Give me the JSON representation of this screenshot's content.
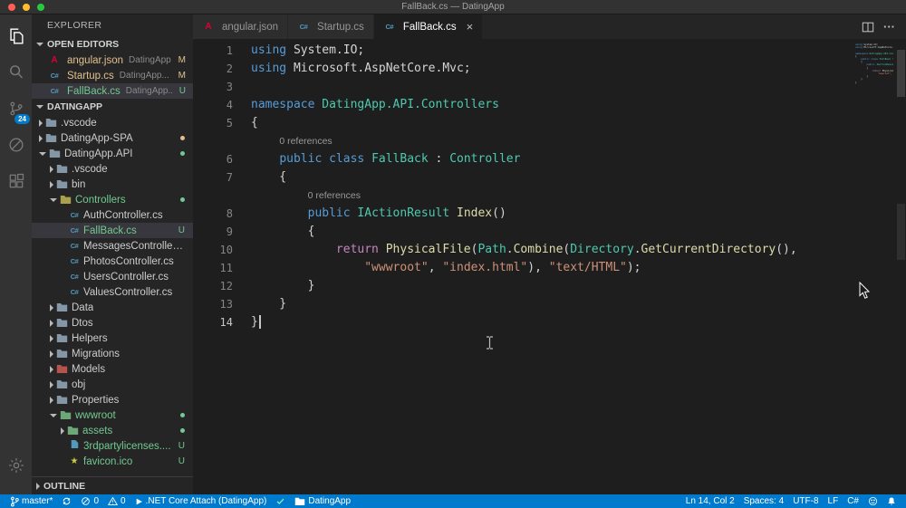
{
  "colors": {
    "accent": "#007acc",
    "modified": "#e2c08d",
    "untracked": "#73c991",
    "keyword": "#569cd6",
    "control": "#c586c0",
    "type": "#4ec9b0",
    "method": "#dcdcaa",
    "string": "#ce9178",
    "default_text": "#d4d4d4"
  },
  "title_bar": {
    "title": "FallBack.cs — DatingApp"
  },
  "activity_bar": {
    "items": [
      {
        "icon": "explorer",
        "active": true
      },
      {
        "icon": "search",
        "active": false
      },
      {
        "icon": "source-control",
        "active": false,
        "badge": "24"
      },
      {
        "icon": "debug",
        "active": false
      },
      {
        "icon": "extensions",
        "active": false
      }
    ],
    "bottom_items": [
      {
        "icon": "settings"
      }
    ]
  },
  "sidebar": {
    "title": "EXPLORER",
    "open_editors_label": "OPEN EDITORS",
    "open_editors": [
      {
        "file": "angular.json",
        "detail": "DatingApp...",
        "badge": "M",
        "icon": "angular",
        "color": "#e2c08d",
        "selected": false
      },
      {
        "file": "Startup.cs",
        "detail": "DatingApp...",
        "badge": "M",
        "icon": "csharp",
        "color": "#e2c08d",
        "selected": false
      },
      {
        "file": "FallBack.cs",
        "detail": "DatingApp...",
        "badge": "U",
        "icon": "csharp",
        "color": "#73c991",
        "selected": true
      }
    ],
    "project_label": "DATINGAPP",
    "tree": [
      {
        "label": ".vscode",
        "kind": "folder",
        "indent": 0,
        "expanded": false
      },
      {
        "label": "DatingApp-SPA",
        "kind": "folder",
        "indent": 0,
        "expanded": false,
        "dot": "#e2c08d"
      },
      {
        "label": "DatingApp.API",
        "kind": "folder",
        "indent": 0,
        "expanded": true,
        "dot": "#73c991"
      },
      {
        "label": ".vscode",
        "kind": "folder",
        "indent": 1,
        "expanded": false
      },
      {
        "label": "bin",
        "kind": "folder",
        "indent": 1,
        "expanded": false
      },
      {
        "label": "Controllers",
        "kind": "folder",
        "indent": 1,
        "expanded": true,
        "color": "#73c991",
        "dot": "#73c991",
        "folder_color": "#a9a14c"
      },
      {
        "label": "AuthController.cs",
        "kind": "file",
        "icon": "csharp",
        "indent": 2
      },
      {
        "label": "FallBack.cs",
        "kind": "file",
        "icon": "csharp",
        "indent": 2,
        "color": "#73c991",
        "badge": "U",
        "selected": true
      },
      {
        "label": "MessagesController.cs",
        "kind": "file",
        "icon": "csharp",
        "indent": 2
      },
      {
        "label": "PhotosController.cs",
        "kind": "file",
        "icon": "csharp",
        "indent": 2
      },
      {
        "label": "UsersController.cs",
        "kind": "file",
        "icon": "csharp",
        "indent": 2
      },
      {
        "label": "ValuesController.cs",
        "kind": "file",
        "icon": "csharp",
        "indent": 2
      },
      {
        "label": "Data",
        "kind": "folder",
        "indent": 1,
        "expanded": false
      },
      {
        "label": "Dtos",
        "kind": "folder",
        "indent": 1,
        "expanded": false
      },
      {
        "label": "Helpers",
        "kind": "folder",
        "indent": 1,
        "expanded": false
      },
      {
        "label": "Migrations",
        "kind": "folder",
        "indent": 1,
        "expanded": false
      },
      {
        "label": "Models",
        "kind": "folder",
        "indent": 1,
        "expanded": false,
        "folder_color": "#b5544c"
      },
      {
        "label": "obj",
        "kind": "folder",
        "indent": 1,
        "expanded": false
      },
      {
        "label": "Properties",
        "kind": "folder",
        "indent": 1,
        "expanded": false
      },
      {
        "label": "wwwroot",
        "kind": "folder",
        "indent": 1,
        "expanded": true,
        "color": "#73c991",
        "dot": "#73c991",
        "folder_color": "#6ca878"
      },
      {
        "label": "assets",
        "kind": "folder",
        "indent": 2,
        "expanded": false,
        "color": "#73c991",
        "dot": "#73c991",
        "folder_color": "#6ca878"
      },
      {
        "label": "3rdpartylicenses....",
        "kind": "file",
        "icon": "doc",
        "indent": 2,
        "color": "#73c991",
        "badge": "U"
      },
      {
        "label": "favicon.ico",
        "kind": "file",
        "icon": "star",
        "indent": 2,
        "color": "#73c991",
        "badge": "U"
      }
    ],
    "outline_label": "OUTLINE"
  },
  "tabs": [
    {
      "label": "angular.json",
      "icon": "angular",
      "active": false
    },
    {
      "label": "Startup.cs",
      "icon": "csharp",
      "active": false
    },
    {
      "label": "FallBack.cs",
      "icon": "csharp",
      "active": true
    }
  ],
  "editor_actions": [
    {
      "icon": "split-editor"
    },
    {
      "icon": "more"
    }
  ],
  "editor": {
    "rows": [
      {
        "n": "1",
        "tokens": [
          [
            "using",
            "k"
          ],
          [
            " System.IO;",
            "d"
          ]
        ]
      },
      {
        "n": "2",
        "tokens": [
          [
            "using",
            "k"
          ],
          [
            " Microsoft.AspNetCore.Mvc;",
            "d"
          ]
        ]
      },
      {
        "n": "3",
        "tokens": []
      },
      {
        "n": "4",
        "tokens": [
          [
            "namespace",
            "k"
          ],
          [
            " ",
            "d"
          ],
          [
            "DatingApp.API.Controllers",
            "t"
          ]
        ]
      },
      {
        "n": "5",
        "tokens": [
          [
            "{",
            "d"
          ]
        ]
      },
      {
        "lens": "0 references",
        "indent": 4
      },
      {
        "n": "6",
        "tokens": [
          [
            "    ",
            "d"
          ],
          [
            "public",
            "k"
          ],
          [
            " ",
            "d"
          ],
          [
            "class",
            "k"
          ],
          [
            " ",
            "d"
          ],
          [
            "FallBack",
            "t"
          ],
          [
            " : ",
            "d"
          ],
          [
            "Controller",
            "t"
          ]
        ]
      },
      {
        "n": "7",
        "tokens": [
          [
            "    {",
            "d"
          ]
        ]
      },
      {
        "lens": "0 references",
        "indent": 8
      },
      {
        "n": "8",
        "tokens": [
          [
            "        ",
            "d"
          ],
          [
            "public",
            "k"
          ],
          [
            " ",
            "d"
          ],
          [
            "IActionResult",
            "t"
          ],
          [
            " ",
            "d"
          ],
          [
            "Index",
            "m"
          ],
          [
            "()",
            "d"
          ]
        ]
      },
      {
        "n": "9",
        "tokens": [
          [
            "        {",
            "d"
          ]
        ]
      },
      {
        "n": "10",
        "tokens": [
          [
            "            ",
            "d"
          ],
          [
            "return",
            "c"
          ],
          [
            " ",
            "d"
          ],
          [
            "PhysicalFile",
            "m"
          ],
          [
            "(",
            "d"
          ],
          [
            "Path",
            "t"
          ],
          [
            ".",
            "d"
          ],
          [
            "Combine",
            "m"
          ],
          [
            "(",
            "d"
          ],
          [
            "Directory",
            "t"
          ],
          [
            ".",
            "d"
          ],
          [
            "GetCurrentDirectory",
            "m"
          ],
          [
            "(),",
            "d"
          ]
        ]
      },
      {
        "n": "11",
        "tokens": [
          [
            "                ",
            "d"
          ],
          [
            "\"wwwroot\"",
            "s"
          ],
          [
            ", ",
            "d"
          ],
          [
            "\"index.html\"",
            "s"
          ],
          [
            "), ",
            "d"
          ],
          [
            "\"text/HTML\"",
            "s"
          ],
          [
            ");",
            "d"
          ]
        ]
      },
      {
        "n": "12",
        "tokens": [
          [
            "        }",
            "d"
          ]
        ]
      },
      {
        "n": "13",
        "tokens": [
          [
            "    }",
            "d"
          ]
        ]
      },
      {
        "n": "14",
        "tokens": [
          [
            "}",
            "d"
          ]
        ],
        "cursor": true,
        "active": true
      }
    ]
  },
  "status_bar": {
    "left": [
      {
        "icon": "branch",
        "label": "master*"
      },
      {
        "icon": "sync",
        "label": ""
      },
      {
        "icon": "error",
        "label": "0"
      },
      {
        "icon": "warning",
        "label": "0"
      },
      {
        "icon": "debug-play",
        "label": ".NET Core Attach (DatingApp)"
      },
      {
        "icon": "check",
        "label": ""
      },
      {
        "icon": "folder",
        "label": "DatingApp"
      }
    ],
    "right": [
      {
        "label": "Ln 14, Col 2"
      },
      {
        "label": "Spaces: 4"
      },
      {
        "label": "UTF-8"
      },
      {
        "label": "LF"
      },
      {
        "label": "C#"
      },
      {
        "icon": "smiley",
        "label": ""
      },
      {
        "icon": "bell",
        "label": ""
      }
    ]
  }
}
